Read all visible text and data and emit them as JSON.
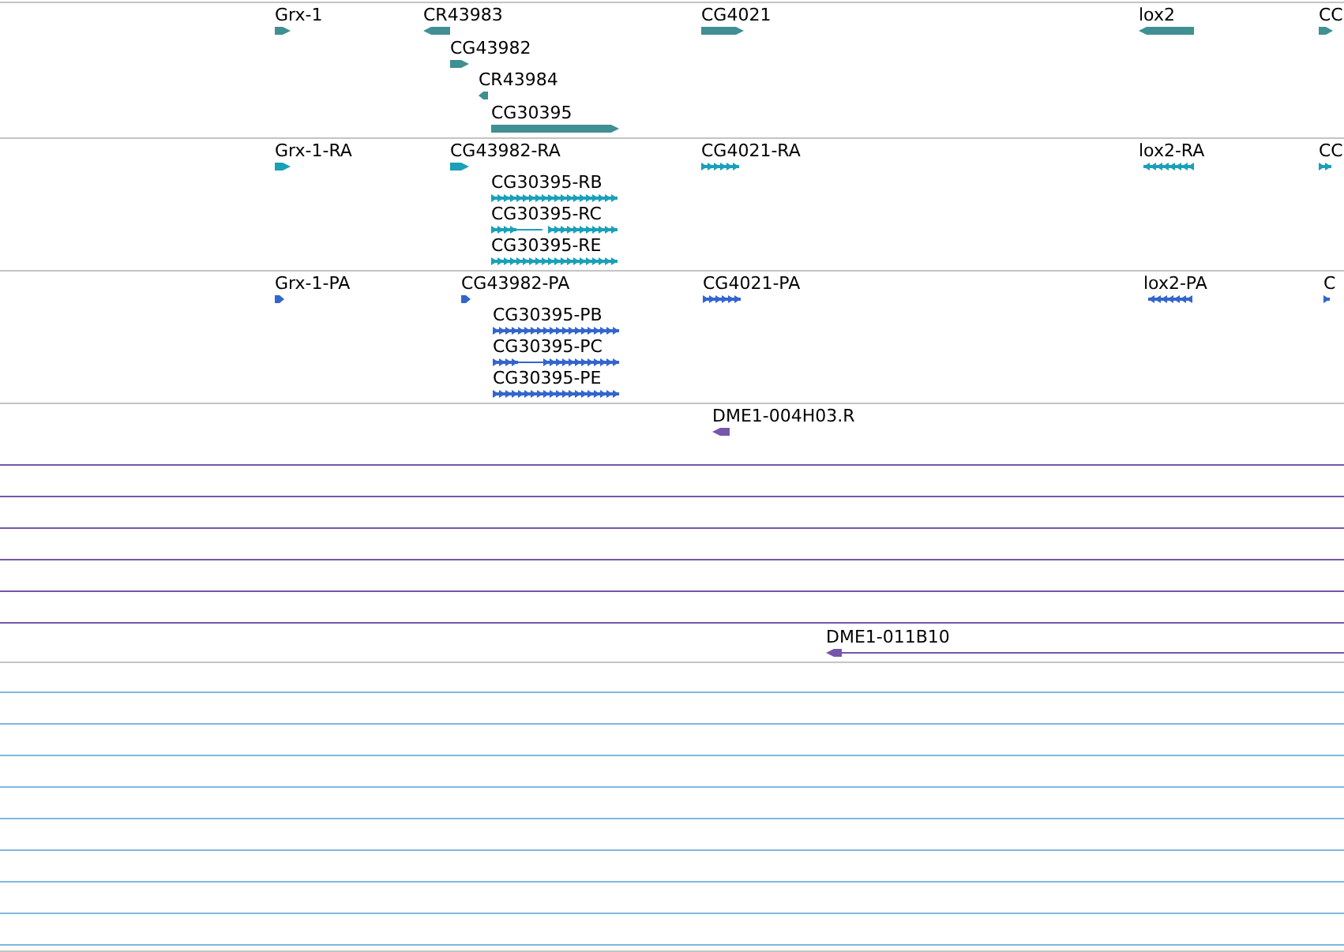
{
  "tracks": [
    {
      "color": "#3f8f93",
      "features": [
        {
          "label": "Grx-1",
          "kind": "gene",
          "reverse": false
        },
        {
          "label": "CR43983",
          "kind": "gene",
          "reverse": true
        },
        {
          "label": "CG43982",
          "kind": "gene",
          "reverse": false
        },
        {
          "label": "CR43984",
          "kind": "gene",
          "reverse": true
        },
        {
          "label": "CG30395",
          "kind": "gene",
          "reverse": false
        },
        {
          "label": "CG4021",
          "kind": "gene",
          "reverse": false
        },
        {
          "label": "lox2",
          "kind": "gene",
          "reverse": true
        },
        {
          "label": "CC",
          "kind": "gene",
          "reverse": false
        }
      ]
    },
    {
      "color": "#1aa0b8",
      "features": [
        {
          "label": "Grx-1-RA",
          "kind": "gene",
          "reverse": false
        },
        {
          "label": "CG43982-RA",
          "kind": "gene",
          "reverse": false
        },
        {
          "label": "CG30395-RB",
          "kind": "exons",
          "reverse": false
        },
        {
          "label": "CG30395-RC",
          "kind": "spliced",
          "reverse": false
        },
        {
          "label": "CG30395-RE",
          "kind": "exons",
          "reverse": false
        },
        {
          "label": "CG4021-RA",
          "kind": "exons",
          "reverse": false
        },
        {
          "label": "lox2-RA",
          "kind": "exons",
          "reverse": true
        },
        {
          "label": "CC",
          "kind": "exons",
          "reverse": false
        }
      ]
    },
    {
      "color": "#3366cc",
      "features": [
        {
          "label": "Grx-1-PA",
          "kind": "gene",
          "reverse": false
        },
        {
          "label": "CG43982-PA",
          "kind": "gene",
          "reverse": false
        },
        {
          "label": "CG30395-PB",
          "kind": "exons",
          "reverse": false
        },
        {
          "label": "CG30395-PC",
          "kind": "spliced",
          "reverse": false
        },
        {
          "label": "CG30395-PE",
          "kind": "exons",
          "reverse": false
        },
        {
          "label": "CG4021-PA",
          "kind": "exons",
          "reverse": false
        },
        {
          "label": "lox2-PA",
          "kind": "exons",
          "reverse": true
        },
        {
          "label": "C",
          "kind": "exons",
          "reverse": false
        }
      ]
    },
    {
      "color": "#7755aa",
      "features": [
        {
          "label": "DME1-004H03.R",
          "kind": "gene",
          "reverse": true
        },
        {
          "kind": "span"
        },
        {
          "kind": "span"
        },
        {
          "kind": "span"
        },
        {
          "kind": "span"
        },
        {
          "kind": "span"
        },
        {
          "kind": "span"
        },
        {
          "label": "DME1-011B10",
          "kind": "tail",
          "reverse": true
        }
      ]
    },
    {
      "color": "#7fb8e0",
      "features": [
        {
          "kind": "span"
        },
        {
          "kind": "span"
        },
        {
          "kind": "span"
        },
        {
          "kind": "span"
        },
        {
          "kind": "span"
        },
        {
          "kind": "span"
        },
        {
          "kind": "span"
        },
        {
          "kind": "span"
        },
        {
          "kind": "span"
        }
      ]
    }
  ]
}
